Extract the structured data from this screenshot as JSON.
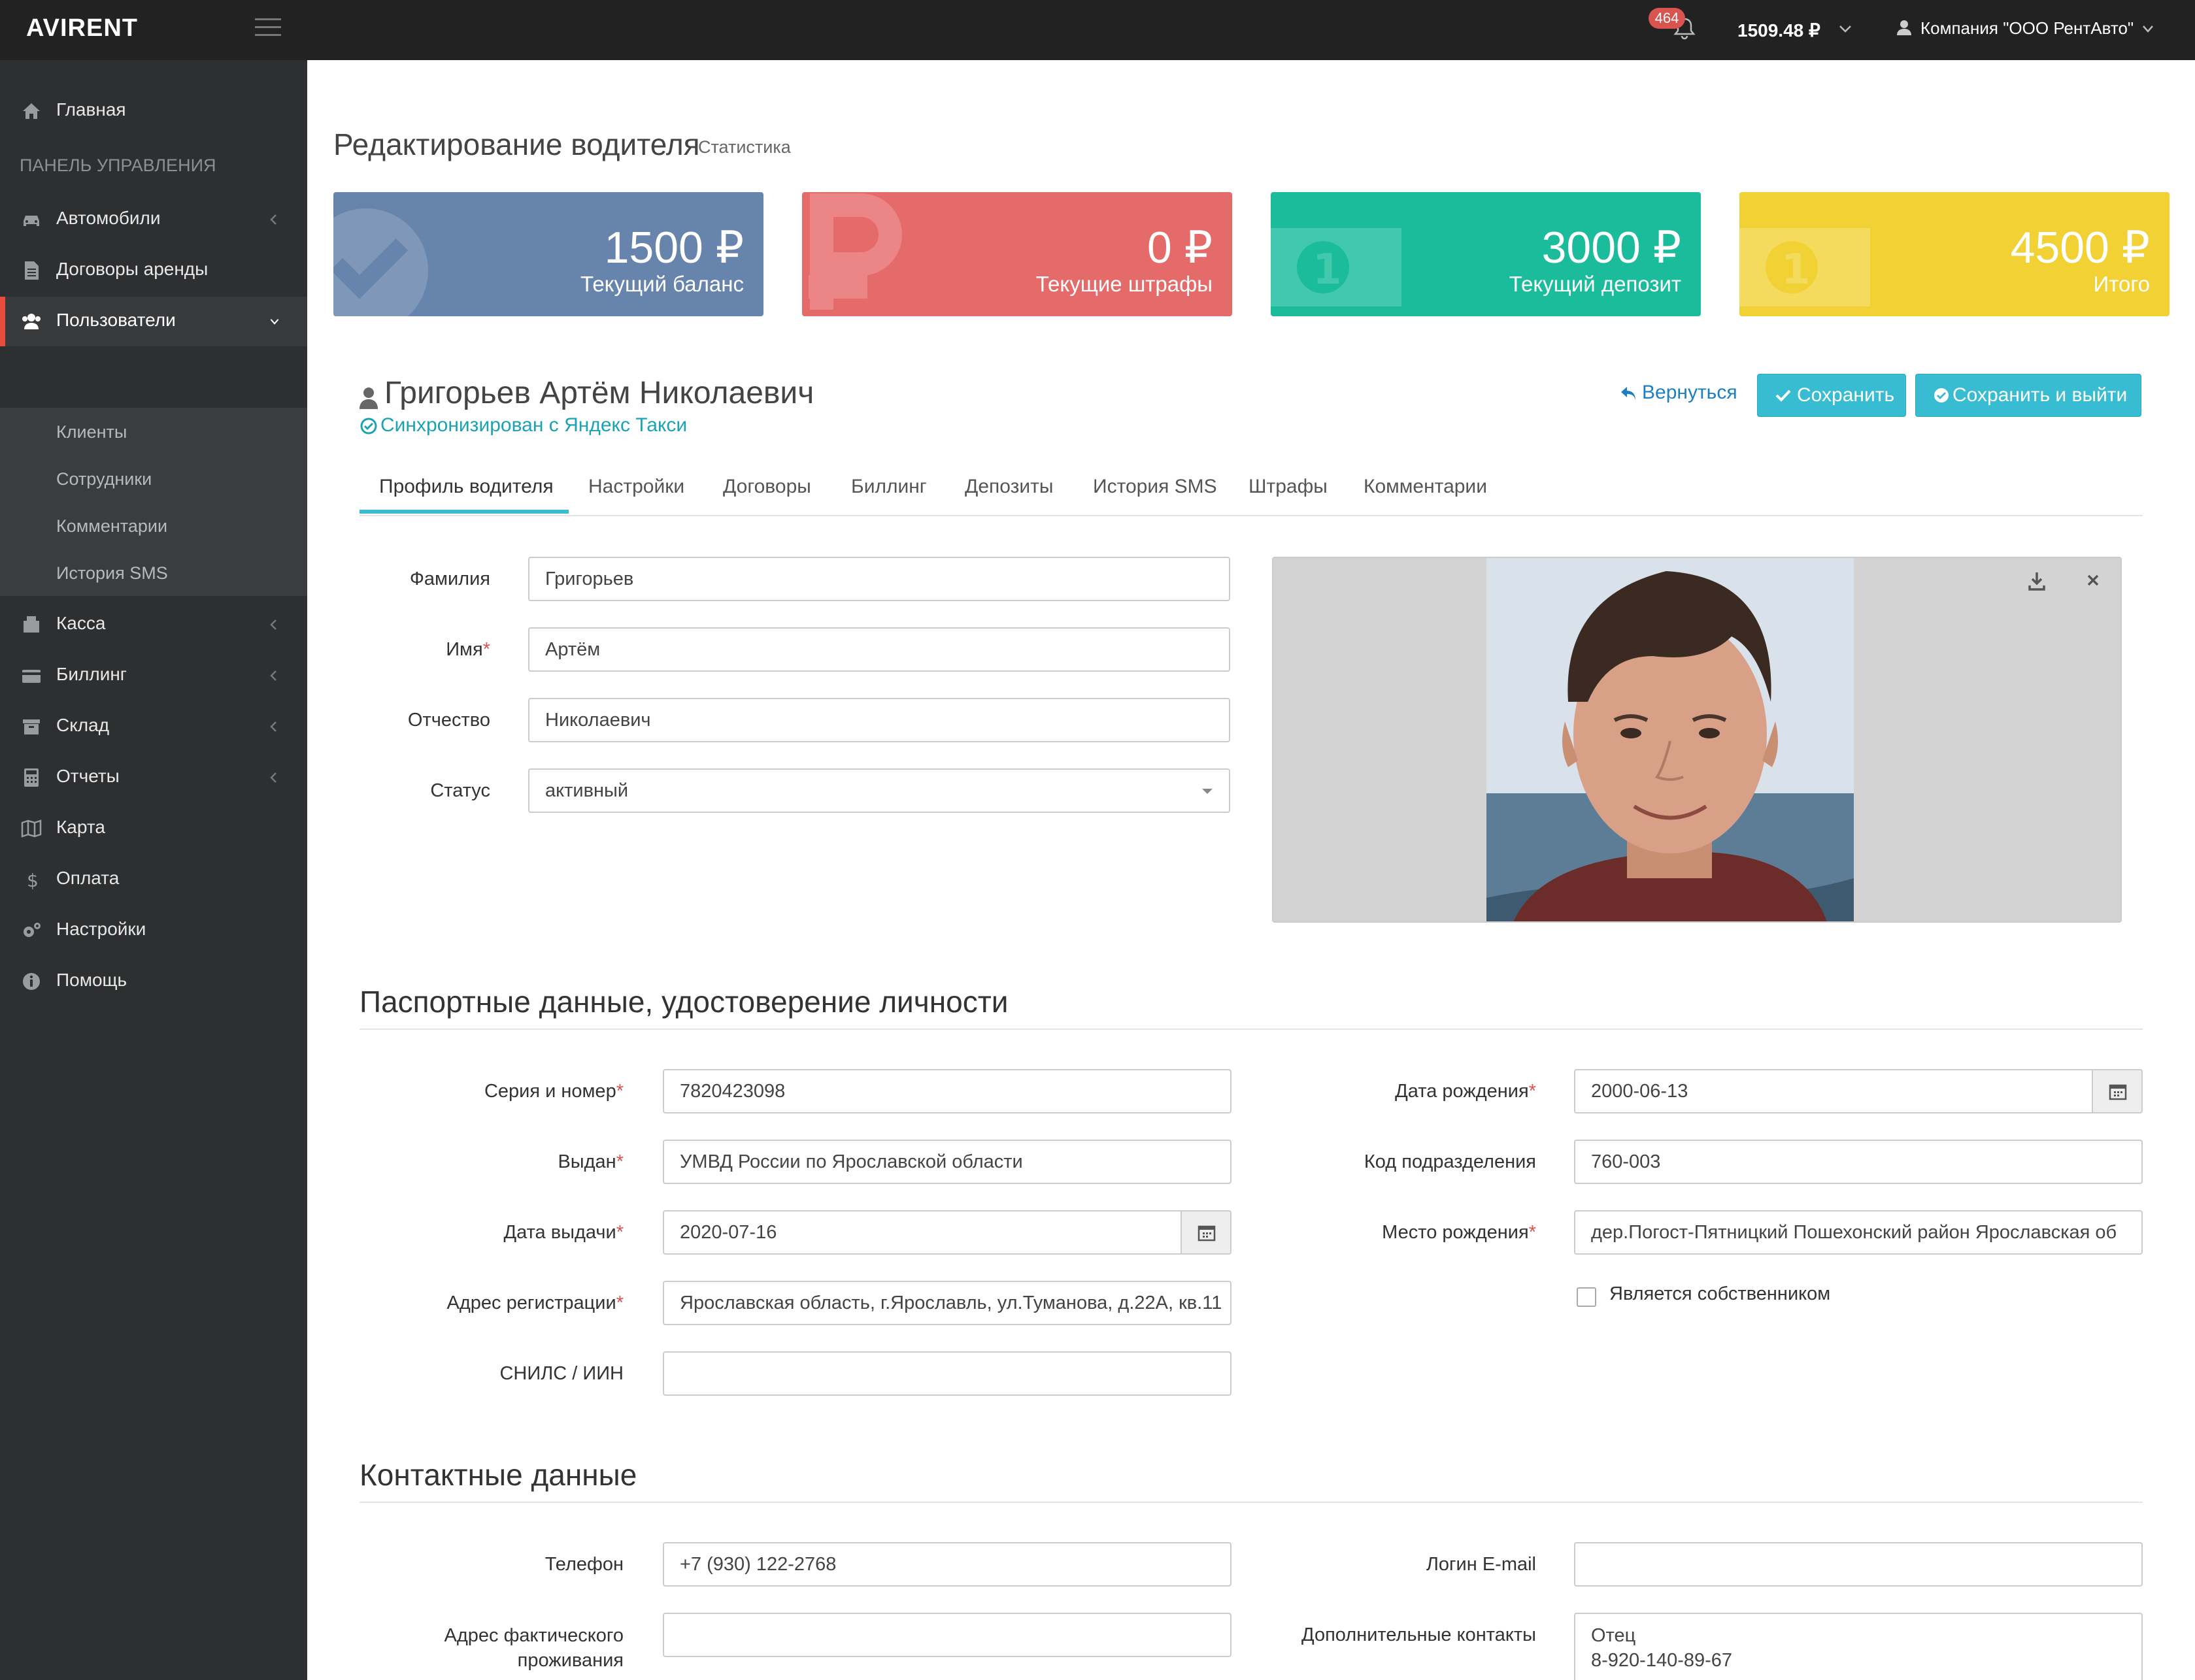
{
  "topbar": {
    "logo": "AVIRENT",
    "notifications": "464",
    "balance": "1509.48 ₽",
    "company": "Компания \"ООО РентАвто\""
  },
  "sidebar": {
    "home": "Главная",
    "panel_header": "ПАНЕЛЬ УПРАВЛЕНИЯ",
    "items": [
      {
        "label": "Автомобили",
        "icon": "car-icon"
      },
      {
        "label": "Договоры аренды",
        "icon": "file-icon"
      },
      {
        "label": "Пользователи",
        "icon": "users-icon"
      },
      {
        "label": "Касса",
        "icon": "cash-register-icon"
      },
      {
        "label": "Биллинг",
        "icon": "credit-card-icon"
      },
      {
        "label": "Склад",
        "icon": "archive-icon"
      },
      {
        "label": "Отчеты",
        "icon": "calculator-icon"
      },
      {
        "label": "Карта",
        "icon": "map-icon"
      },
      {
        "label": "Оплата",
        "icon": "dollar-icon"
      },
      {
        "label": "Настройки",
        "icon": "gears-icon"
      },
      {
        "label": "Помощь",
        "icon": "info-icon"
      }
    ],
    "sub_items": [
      "Клиенты",
      "Сотрудники",
      "Комментарии",
      "История SMS"
    ],
    "active": "Пользователи"
  },
  "page": {
    "title": "Редактирование водителя",
    "subtitle": "Статистика"
  },
  "stats": [
    {
      "value": "1500 ₽",
      "caption": "Текущий баланс",
      "color": "#6784ac"
    },
    {
      "value": "0 ₽",
      "caption": "Текущие штрафы",
      "color": "#e56b6b"
    },
    {
      "value": "3000 ₽",
      "caption": "Текущий депозит",
      "color": "#1bbc9b"
    },
    {
      "value": "4500 ₽",
      "caption": "Итого",
      "color": "#f2d134"
    }
  ],
  "driver": {
    "name": "Григорьев Артём Николаевич",
    "sync": "Синхронизирован с Яндекс Такси"
  },
  "actions": {
    "back": "Вернуться",
    "save": "Сохранить",
    "save_exit": "Сохранить и выйти"
  },
  "tabs": [
    "Профиль водителя",
    "Настройки",
    "Договоры",
    "Биллинг",
    "Депозиты",
    "История SMS",
    "Штрафы",
    "Комментарии"
  ],
  "profile": {
    "last_name": {
      "label": "Фамилия",
      "value": "Григорьев"
    },
    "first_name": {
      "label": "Имя",
      "value": "Артём"
    },
    "middle_name": {
      "label": "Отчество",
      "value": "Николаевич"
    },
    "status": {
      "label": "Статус",
      "value": "активный"
    }
  },
  "passport": {
    "section": "Паспортные данные, удостоверение личности",
    "number": {
      "label": "Серия и номер",
      "value": "7820423098"
    },
    "issued_by": {
      "label": "Выдан",
      "value": "УМВД России по Ярославской области"
    },
    "issue_date": {
      "label": "Дата выдачи",
      "value": "2020-07-16"
    },
    "reg_address": {
      "label": "Адрес регистрации",
      "value": "Ярославская область, г.Ярославль, ул.Туманова, д.22А, кв.11"
    },
    "snils": {
      "label": "СНИЛС / ИИН",
      "value": ""
    },
    "birth_date": {
      "label": "Дата рождения",
      "value": "2000-06-13"
    },
    "division_code": {
      "label": "Код подразделения",
      "value": "760-003"
    },
    "birth_place": {
      "label": "Место рождения",
      "value": "дер.Погост-Пятницкий Пошехонский район Ярославская об"
    },
    "owner": {
      "label": "Является собственником"
    }
  },
  "contacts": {
    "section": "Контактные данные",
    "phone": {
      "label": "Телефон",
      "value": "+7 (930) 122-2768"
    },
    "actual_address": {
      "label_1": "Адрес фактического",
      "label_2": "проживания",
      "value": ""
    },
    "email": {
      "label": "Логин E-mail",
      "value": ""
    },
    "extra": {
      "label": "Дополнительные контакты",
      "line_1": "Отец",
      "line_2": "8-920-140-89-67"
    }
  }
}
